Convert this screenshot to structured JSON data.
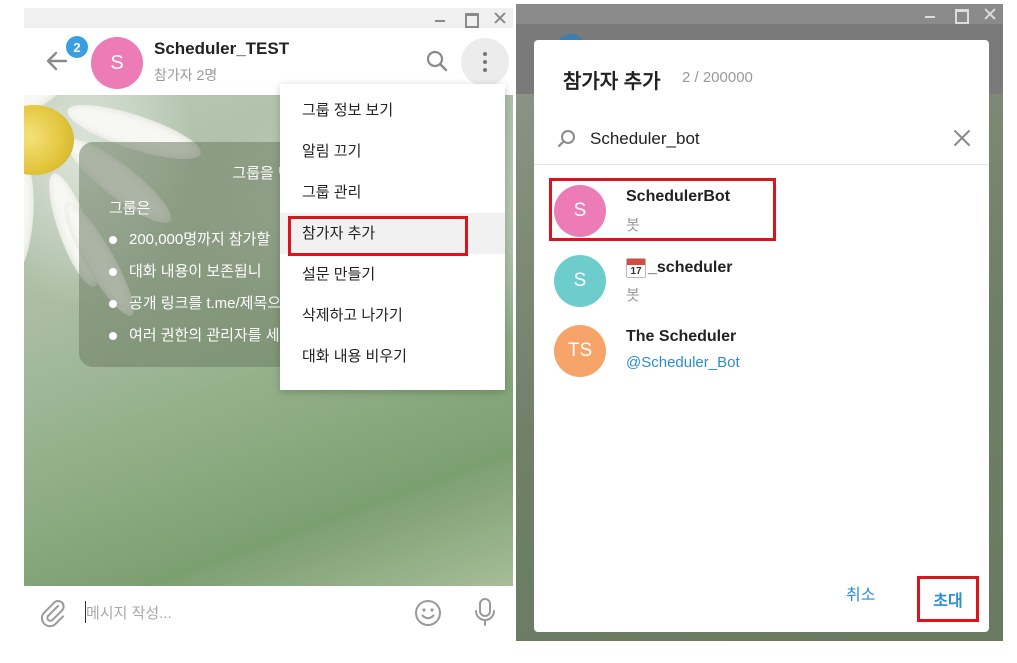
{
  "left_window": {
    "header": {
      "unread_count": "2",
      "avatar_letter": "S",
      "title": "Scheduler_TEST",
      "subtitle": "참가자 2명"
    },
    "empty_card": {
      "title": "그룹을 만드",
      "intro": "그룹은",
      "features": [
        "200,000명까지 참가할",
        "대화 내용이 보존됩니",
        "공개 링크를 t.me/제목으로 할 수 있습니다",
        "여러 권한의 관리자를 세울 수 있습니다"
      ]
    },
    "menu": {
      "items": [
        "그룹 정보 보기",
        "알림 끄기",
        "그룹 관리",
        "참가자 추가",
        "설문 만들기",
        "삭제하고 나가기",
        "대화 내용 비우기"
      ]
    },
    "composer": {
      "placeholder": "메시지 작성..."
    }
  },
  "dialog": {
    "title": "참가자 추가",
    "count": "2 / 200000",
    "search_value": "Scheduler_bot",
    "results": [
      {
        "avatar": "S",
        "avatar_color": "#ed7bb6",
        "name": "SchedulerBot",
        "sub": "봇"
      },
      {
        "avatar": "S",
        "avatar_color": "#6dcccc",
        "name": "_scheduler",
        "name_icon": "calendar-icon",
        "calendar_day": "17",
        "sub": "봇"
      },
      {
        "avatar": "TS",
        "avatar_color": "#f7a46a",
        "name": "The Scheduler",
        "sub": "@Scheduler_Bot"
      }
    ],
    "cancel_label": "취소",
    "invite_label": "초대"
  },
  "colors": {
    "accent": "#2a8dd4",
    "badge": "#3a9fe0",
    "highlight_outline": "#d9141b"
  }
}
